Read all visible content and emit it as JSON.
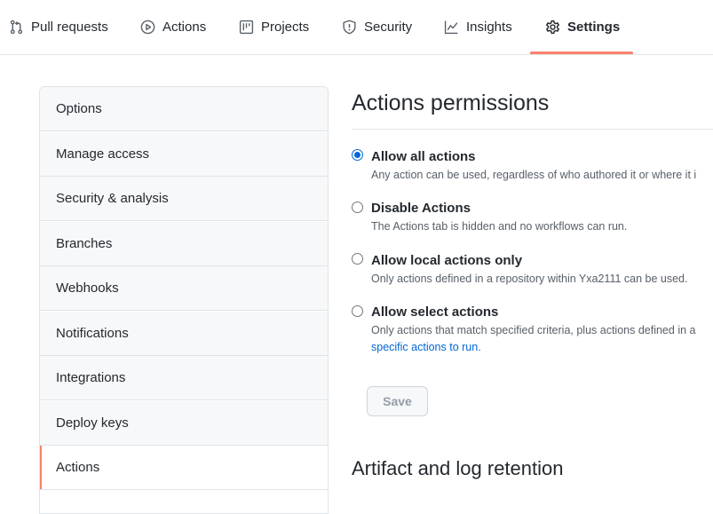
{
  "tabs": [
    {
      "label": "Pull requests",
      "icon": "git-pull-request-icon"
    },
    {
      "label": "Actions",
      "icon": "play-icon"
    },
    {
      "label": "Projects",
      "icon": "project-board-icon"
    },
    {
      "label": "Security",
      "icon": "shield-icon"
    },
    {
      "label": "Insights",
      "icon": "graph-icon"
    },
    {
      "label": "Settings",
      "icon": "gear-icon",
      "selected": true
    }
  ],
  "sidebar": {
    "items": [
      {
        "label": "Options"
      },
      {
        "label": "Manage access"
      },
      {
        "label": "Security & analysis"
      },
      {
        "label": "Branches"
      },
      {
        "label": "Webhooks"
      },
      {
        "label": "Notifications"
      },
      {
        "label": "Integrations"
      },
      {
        "label": "Deploy keys"
      },
      {
        "label": "Actions",
        "selected": true
      }
    ]
  },
  "main": {
    "title": "Actions permissions",
    "options": [
      {
        "label": "Allow all actions",
        "description": "Any action can be used, regardless of who authored it or where it i",
        "checked": true
      },
      {
        "label": "Disable Actions",
        "description": "The Actions tab is hidden and no workflows can run.",
        "checked": false
      },
      {
        "label": "Allow local actions only",
        "description": "Only actions defined in a repository within Yxa2111 can be used.",
        "checked": false
      },
      {
        "label": "Allow select actions",
        "description": "Only actions that match specified criteria, plus actions defined in a",
        "link": "specific actions to run.",
        "checked": false
      }
    ],
    "save_label": "Save",
    "section2_title": "Artifact and log retention"
  },
  "colors": {
    "accent_underline": "#f9826c",
    "link": "#0366d6",
    "radio_selected": "#0366d6"
  }
}
